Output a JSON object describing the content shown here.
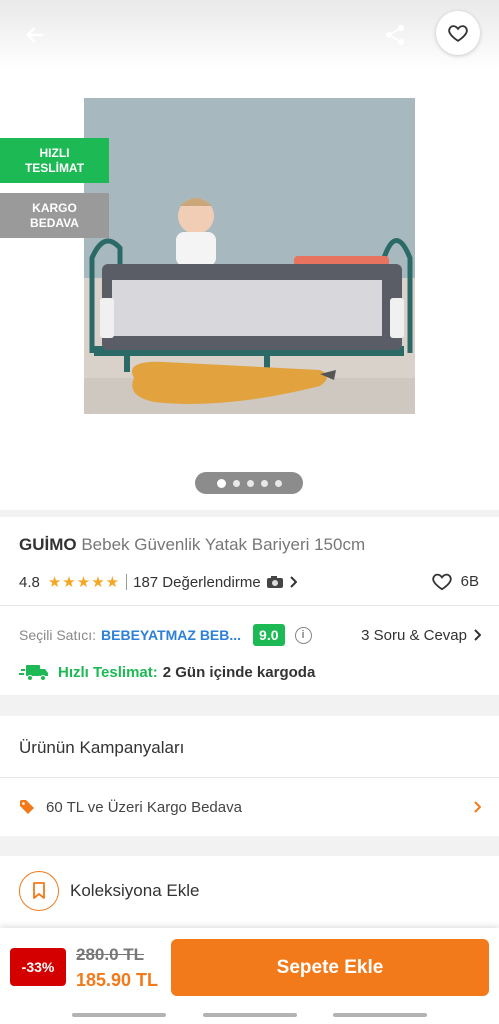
{
  "header": {
    "back_icon": "arrow-left-icon",
    "share_icon": "share-icon",
    "favorite_icon": "heart-icon"
  },
  "gallery": {
    "badges": [
      {
        "line1": "HIZLI",
        "line2": "TESLİMAT",
        "color": "#1db954"
      },
      {
        "line1": "KARGO",
        "line2": "BEDAVA",
        "color": "#9a9a9a"
      }
    ],
    "image_count": 5,
    "current_image": 1
  },
  "product": {
    "brand": "GUİMO",
    "name": "Bebek Güvenlik Yatak Bariyeri 150cm",
    "rating": "4.8",
    "stars": "★★★★★",
    "review_count": "187 Değerlendirme",
    "likes": "6B"
  },
  "seller": {
    "label": "Seçili Satıcı:",
    "name": "BEBEYATMAZ BEB...",
    "score": "9.0",
    "qa": "3 Soru & Cevap"
  },
  "delivery": {
    "label": "Hızlı Teslimat:",
    "text": "2 Gün içinde kargoda"
  },
  "campaigns": {
    "title": "Ürünün Kampanyaları",
    "items": [
      {
        "text": "60 TL ve Üzeri Kargo Bedava"
      }
    ]
  },
  "collection": {
    "label": "Koleksiyona Ekle"
  },
  "purchase": {
    "discount": "-33%",
    "old_price": "280.0 TL",
    "new_price": "185.90 TL",
    "add_to_cart": "Sepete Ekle"
  },
  "colors": {
    "accent": "#f27a1a",
    "green": "#1db954",
    "discount_red": "#d40000",
    "seller_blue": "#2d7fd8"
  }
}
